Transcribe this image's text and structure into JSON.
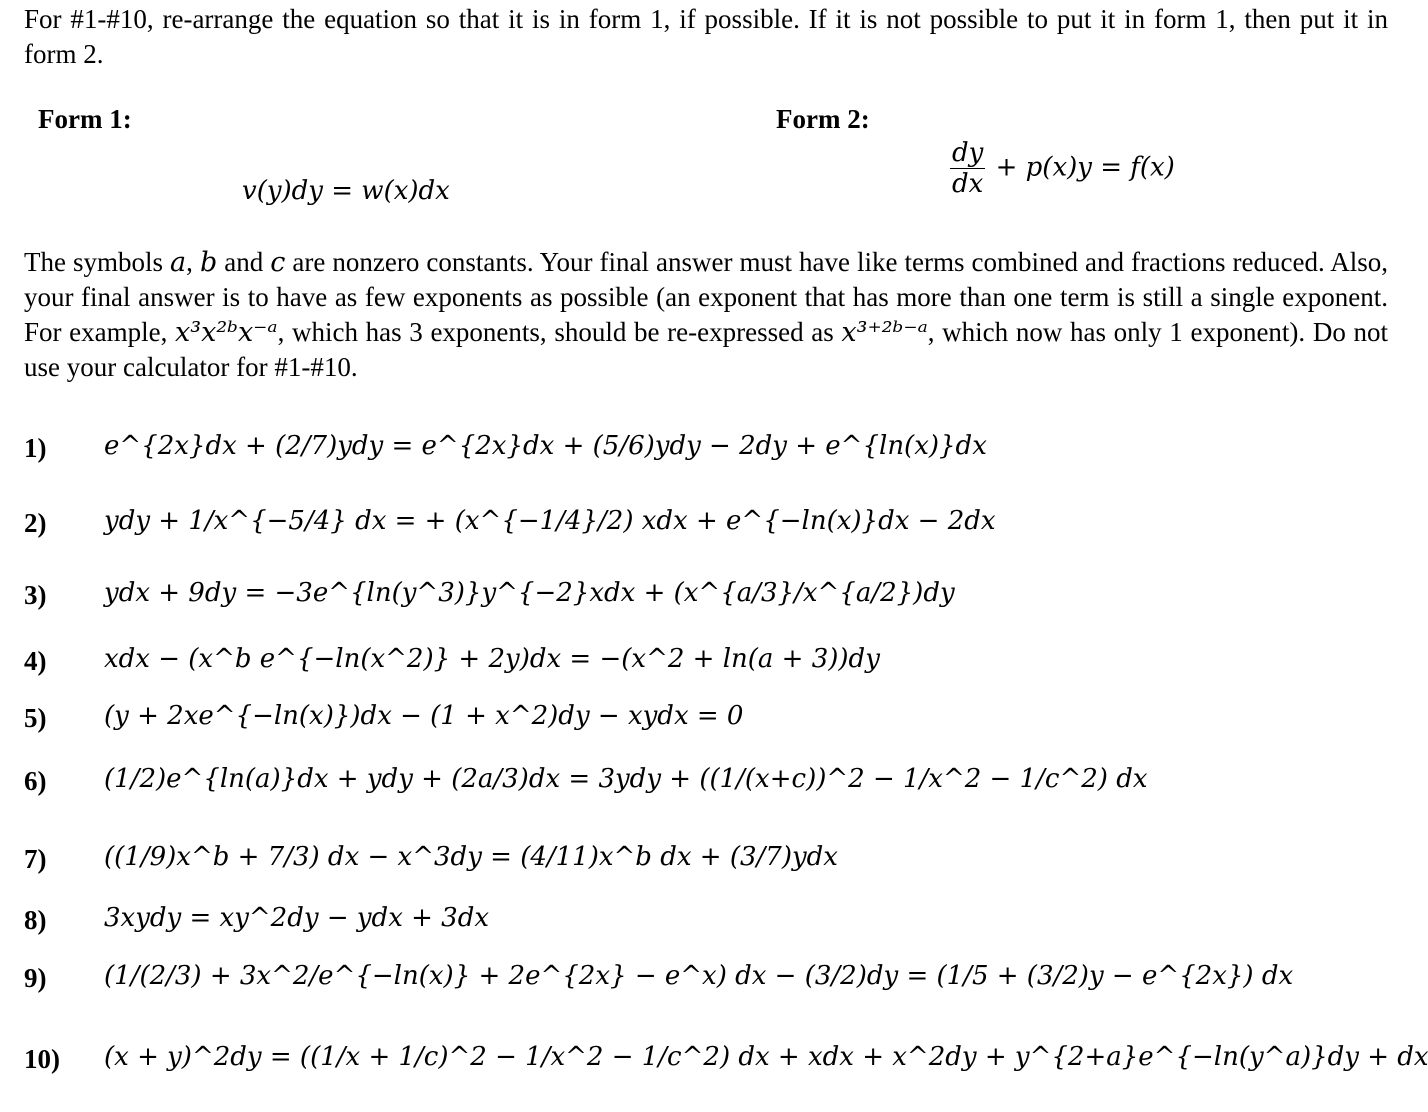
{
  "intro": "For #1-#10, re-arrange the equation so that it is in form 1, if possible. If it is not possible to put it in form 1, then put it in form 2.",
  "form1": {
    "heading": "Form 1:",
    "formula": "v(y)dy = w(x)dx"
  },
  "form2": {
    "heading": "Form 2:",
    "numerator": "dy",
    "denominator": "dx",
    "rest": "+ p(x)y = f(x)"
  },
  "instructions": {
    "part1": "The symbols ",
    "sym_a": "a",
    "sep1": ", ",
    "sym_b": "b",
    "sep2": " and ",
    "sym_c": "c",
    "part2": " are nonzero constants. Your final answer must have like terms combined and fractions reduced. Also, your final answer is to have as few exponents as possible (an exponent that has more than one term is still a single exponent. For example, ",
    "example_expr": "x³x²ᵇx⁻ᵃ",
    "part3": ", which has 3 exponents, should be re-expressed as ",
    "example_result": "x³⁺²ᵇ⁻ᵃ",
    "part4": ", which now has only 1 exponent).  Do not use your calculator for #1-#10."
  },
  "problems": [
    {
      "number": "1)",
      "equation": "e^{2x}dx + (2/7)ydy = e^{2x}dx + (5/6)ydy − 2dy + e^{ln(x)}dx"
    },
    {
      "number": "2)",
      "equation": "ydy + 1/x^{−5/4} dx = + (x^{−1/4}/2) xdx + e^{−ln(x)}dx − 2dx"
    },
    {
      "number": "3)",
      "equation": "ydx + 9dy = −3e^{ln(y^3)}y^{−2}xdx + (x^{a/3}/x^{a/2})dy"
    },
    {
      "number": "4)",
      "equation": "xdx − (x^b e^{−ln(x^2)} + 2y)dx = −(x^2 + ln(a + 3))dy"
    },
    {
      "number": "5)",
      "equation": "(y + 2xe^{−ln(x)})dx − (1 + x^2)dy − xydx = 0"
    },
    {
      "number": "6)",
      "equation": "(1/2)e^{ln(a)}dx + ydy + (2a/3)dx = 3ydy + ((1/(x+c))^2 − 1/x^2 − 1/c^2) dx"
    },
    {
      "number": "7)",
      "equation": "((1/9)x^b + 7/3) dx − x^3dy = (4/11)x^b dx + (3/7)ydx"
    },
    {
      "number": "8)",
      "equation": "3xydy = xy^2dy − ydx + 3dx"
    },
    {
      "number": "9)",
      "equation": "(1/(2/3) + 3x^2/e^{−ln(x)} + 2e^{2x} − e^x) dx − (3/2)dy = (1/5 + (3/2)y − e^{2x}) dx"
    },
    {
      "number": "10)",
      "equation": "(x + y)^2dy = ((1/x + 1/c)^2 − 1/x^2 − 1/c^2) dx + xdx + x^2dy + y^{2+a}e^{−ln(y^a)}dy + dx"
    }
  ]
}
